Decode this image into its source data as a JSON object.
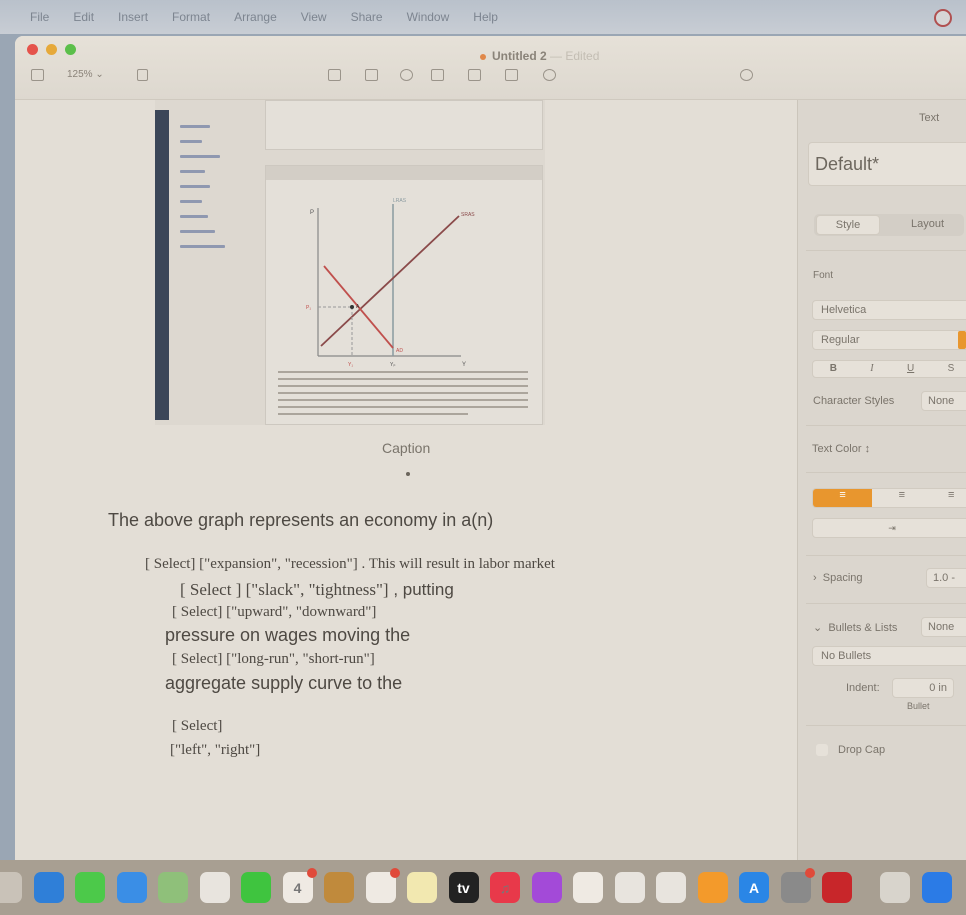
{
  "menubar": {
    "items": [
      "File",
      "Edit",
      "Insert",
      "Format",
      "Arrange",
      "View",
      "Share",
      "Window",
      "Help"
    ]
  },
  "window": {
    "title": "Untitled 2",
    "edited": "— Edited",
    "zoom": "125%"
  },
  "toolbar": {
    "icons": [
      "sidebar-icon",
      "insert-page-icon",
      "table-icon",
      "chart-icon",
      "text-icon",
      "shape-icon",
      "media-icon",
      "comment-icon",
      "collaborate-icon"
    ]
  },
  "document": {
    "graph": {
      "labels": {
        "p_axis": "P",
        "y_axis": "Y",
        "lras": "LRAS",
        "sras": "SRAS",
        "ad": "AD",
        "point": "A",
        "p1": "P₁",
        "y1": "Y₁",
        "yp": "Yₚ"
      },
      "colors": {
        "ad": "#c0504d",
        "sras": "#8a4a4a",
        "lras": "#8a9aa0"
      }
    },
    "caption": "Caption",
    "lines": [
      "The above graph represents an economy in a(n)",
      "[ Select]    [\"expansion\", \"recession\"]   . This will result in labor market",
      "[ Select ]    [\"slack\", \"tightness\"]",
      ", putting",
      "[ Select] [\"upward\", \"downward\"]",
      "pressure on wages moving the",
      "[ Select]  [\"long-run\", \"short-run\"]",
      "aggregate supply curve to the",
      "[ Select]",
      "[\"left\", \"right\"]"
    ]
  },
  "sidebar": {
    "tab": "Text",
    "style_name": "Default*",
    "style_tab": "Style",
    "layout_tab": "Layout",
    "font_label": "Font",
    "font": "Helvetica",
    "weight": "Regular",
    "format_buttons": [
      "B",
      "I",
      "U",
      "S"
    ],
    "char_styles_label": "Character Styles",
    "char_styles": "None",
    "text_color_label": "Text Color ↕",
    "spacing_label": "Spacing",
    "spacing": "1.0 -",
    "bullets_label": "Bullets & Lists",
    "bullets": "None",
    "no_bullets": "No Bullets",
    "indent_label": "Indent:",
    "indent": "0 in",
    "bullet_label": "Bullet",
    "drop_cap": "Drop Cap",
    "accent": "#e8962e"
  },
  "dock": {
    "apps": [
      {
        "name": "launchpad",
        "color": "#c9c2b8"
      },
      {
        "name": "safari",
        "color": "#2f7fd8"
      },
      {
        "name": "messages",
        "color": "#4cc94a"
      },
      {
        "name": "mail",
        "color": "#3a8ee6"
      },
      {
        "name": "maps",
        "color": "#8fc07a"
      },
      {
        "name": "photos",
        "color": "#e8e4de"
      },
      {
        "name": "facetime",
        "color": "#3fc43f"
      },
      {
        "name": "calendar",
        "color": "#efeae3",
        "text": "4",
        "badge": true
      },
      {
        "name": "contacts",
        "color": "#c08a3c"
      },
      {
        "name": "reminders",
        "color": "#efeae3",
        "badge": true
      },
      {
        "name": "notes",
        "color": "#f2e8b0"
      },
      {
        "name": "tv",
        "color": "#222",
        "text": "tv"
      },
      {
        "name": "music",
        "color": "#e8394a",
        "text": "♫"
      },
      {
        "name": "podcasts",
        "color": "#a34ad8"
      },
      {
        "name": "news",
        "color": "#efeae3"
      },
      {
        "name": "keynote",
        "color": "#e8e4de"
      },
      {
        "name": "numbers",
        "color": "#e8e4de"
      },
      {
        "name": "pages",
        "color": "#f39a2b"
      },
      {
        "name": "app-store",
        "color": "#2a86e6",
        "text": "A"
      },
      {
        "name": "system-preferences",
        "color": "#8a8a8a",
        "badge": true
      },
      {
        "name": "acrobat",
        "color": "#c8262a"
      },
      {
        "name": "calculator",
        "color": "#d8d4cc"
      },
      {
        "name": "zoom",
        "color": "#2b7be6"
      }
    ]
  }
}
